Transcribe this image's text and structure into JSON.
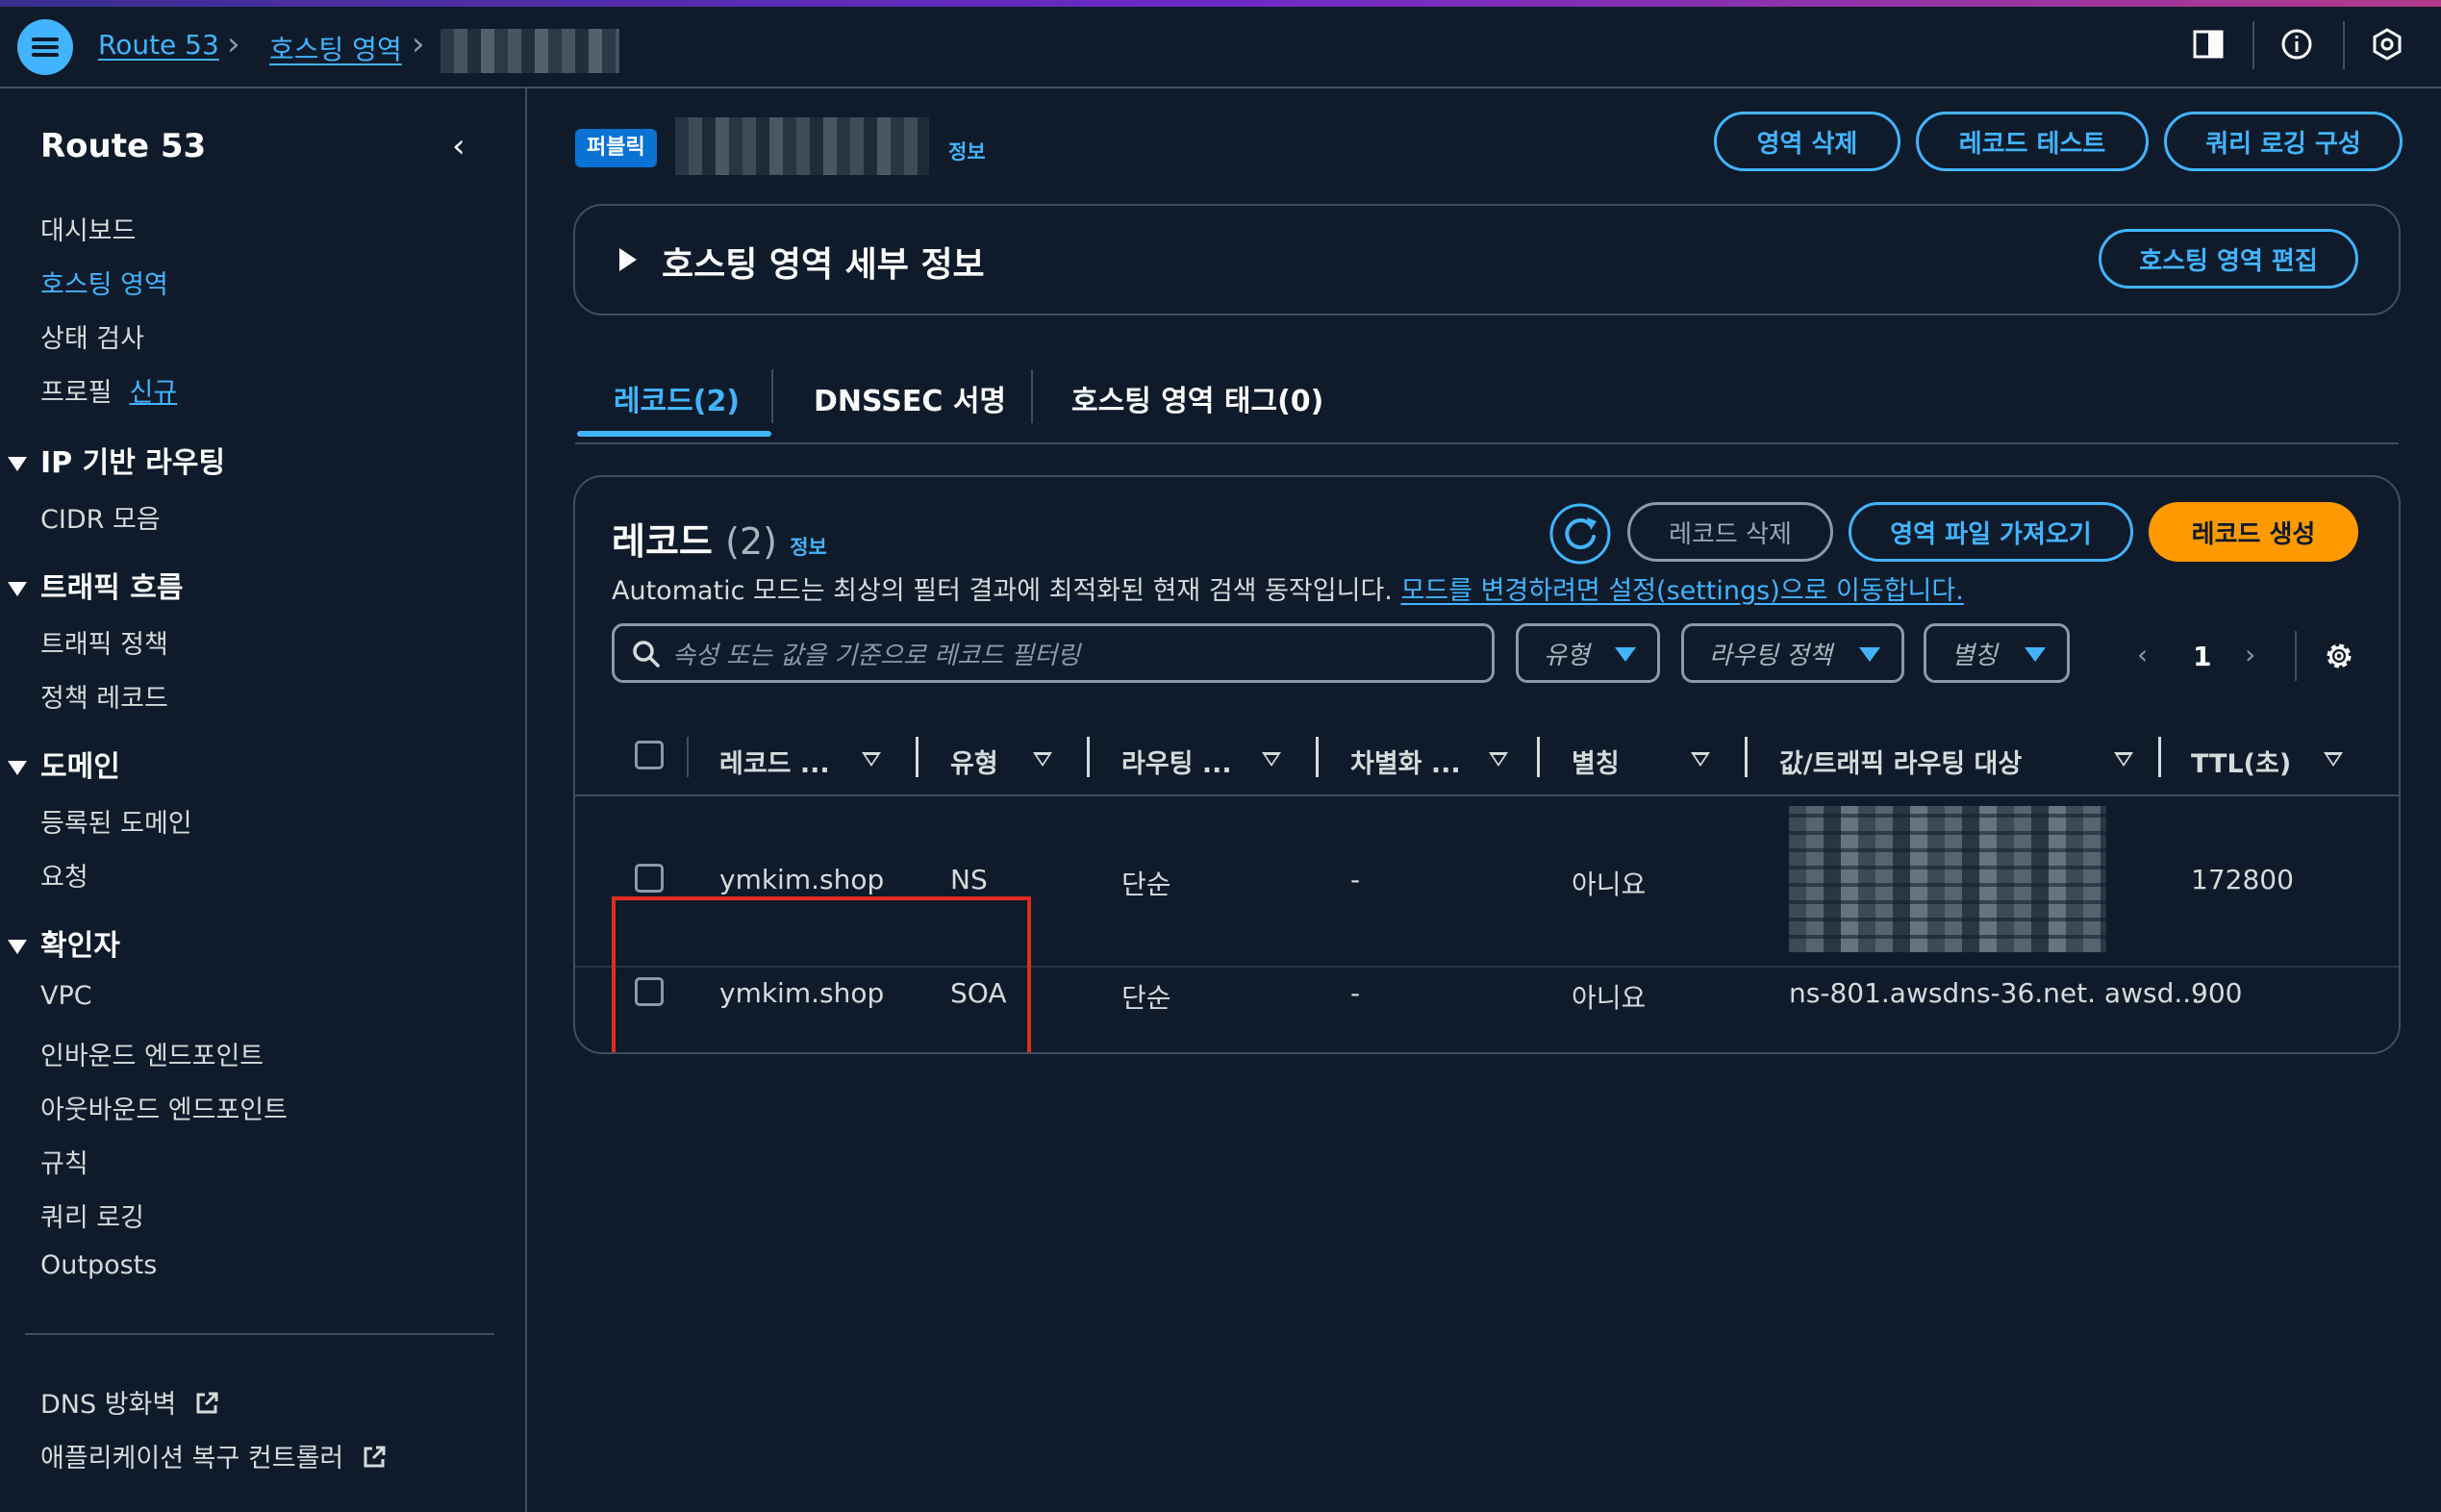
{
  "breadcrumb": {
    "items": [
      "Route 53",
      "호스팅 영역"
    ]
  },
  "sidebar": {
    "title": "Route 53",
    "items_top": [
      "대시보드",
      "호스팅 영역",
      "상태 검사",
      "프로필"
    ],
    "profile_new_badge": "신규",
    "sections": [
      {
        "title": "IP 기반 라우팅",
        "items": [
          "CIDR 모음"
        ]
      },
      {
        "title": "트래픽 흐름",
        "items": [
          "트래픽 정책",
          "정책 레코드"
        ]
      },
      {
        "title": "도메인",
        "items": [
          "등록된 도메인",
          "요청"
        ]
      },
      {
        "title": "확인자",
        "items": [
          "VPC",
          "인바운드 엔드포인트",
          "아웃바운드 엔드포인트",
          "규칙",
          "쿼리 로깅",
          "Outposts"
        ]
      }
    ],
    "external_links": [
      "DNS 방화벽",
      "애플리케이션 복구 컨트롤러"
    ]
  },
  "header": {
    "badge": "퍼블릭",
    "info": "정보",
    "buttons": {
      "delete_zone": "영역 삭제",
      "test_record": "레코드 테스트",
      "query_logging": "쿼리 로깅 구성"
    }
  },
  "details": {
    "title": "호스팅 영역 세부 정보",
    "edit_button": "호스팅 영역 편집"
  },
  "tabs": [
    {
      "label": "레코드(2)",
      "active": true
    },
    {
      "label": "DNSSEC 서명",
      "active": false
    },
    {
      "label": "호스팅 영역 태그(0)",
      "active": false
    }
  ],
  "records": {
    "title": "레코드",
    "count": "(2)",
    "info": "정보",
    "buttons": {
      "delete": "레코드 삭제",
      "import": "영역 파일 가져오기",
      "create": "레코드 생성"
    },
    "description": "Automatic 모드는 최상의 필터 결과에 최적화된 현재 검색 동작입니다.",
    "description_link": "모드를 변경하려면 설정(settings)으로 이동합니다.",
    "search_placeholder": "속성 또는 값을 기준으로 레코드 필터링",
    "filters": [
      "유형",
      "라우팅 정책",
      "별칭"
    ],
    "page": "1",
    "columns": [
      "레코드 ...",
      "유형",
      "라우팅 ...",
      "차별화 ...",
      "별칭",
      "값/트래픽 라우팅 대상",
      "TTL(초)"
    ],
    "rows": [
      {
        "name": "ymkim.shop",
        "type": "NS",
        "routing": "단순",
        "diff": "-",
        "alias": "아니요",
        "value": "",
        "ttl": "172800"
      },
      {
        "name": "ymkim.shop",
        "type": "SOA",
        "routing": "단순",
        "diff": "-",
        "alias": "아니요",
        "value": "ns-801.awsdns-36.net. awsd...",
        "ttl": "900"
      }
    ]
  },
  "colors": {
    "accent": "#42b4ff",
    "primary": "#ff9900",
    "highlight": "#e22b1e",
    "background": "#0f1b2a"
  }
}
